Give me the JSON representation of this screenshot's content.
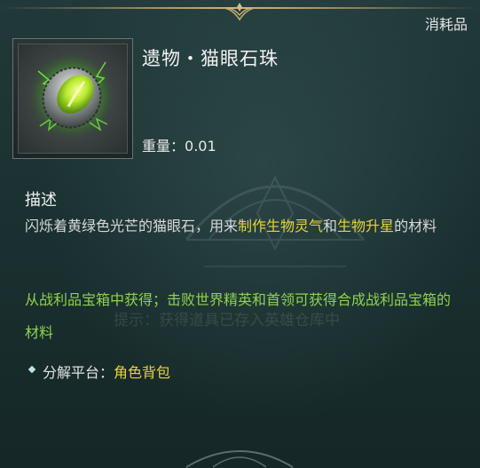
{
  "header": {
    "category": "消耗品"
  },
  "item": {
    "name": "遗物・猫眼石珠",
    "weight_label": "重量：",
    "weight_value": "0.01",
    "icon": "cat-eye-gem-icon"
  },
  "description": {
    "title": "描述",
    "part1": "闪烁着黄绿色光芒的猫眼石，用来",
    "highlight1": "制作生物灵气",
    "part2": "和",
    "highlight2": "生物升星",
    "part3": "的材料"
  },
  "source": {
    "text": "从战利品宝箱中获得；击败世界精英和首领可获得合成战利品宝箱的材料"
  },
  "faded_hint": "提示：获得道具已存入英雄仓库中",
  "platform": {
    "label": "分解平台：",
    "value": "角色背包"
  },
  "colors": {
    "highlight": "#e7d33a",
    "source_green": "#8fd24f",
    "background": "#1b3131"
  }
}
